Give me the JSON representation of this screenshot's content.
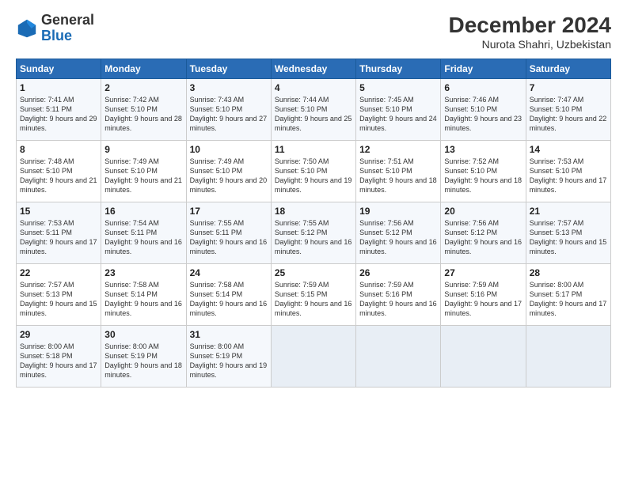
{
  "logo": {
    "name1": "General",
    "name2": "Blue"
  },
  "header": {
    "title": "December 2024",
    "subtitle": "Nurota Shahri, Uzbekistan"
  },
  "weekdays": [
    "Sunday",
    "Monday",
    "Tuesday",
    "Wednesday",
    "Thursday",
    "Friday",
    "Saturday"
  ],
  "weeks": [
    [
      {
        "day": "1",
        "sunrise": "Sunrise: 7:41 AM",
        "sunset": "Sunset: 5:11 PM",
        "daylight": "Daylight: 9 hours and 29 minutes."
      },
      {
        "day": "2",
        "sunrise": "Sunrise: 7:42 AM",
        "sunset": "Sunset: 5:10 PM",
        "daylight": "Daylight: 9 hours and 28 minutes."
      },
      {
        "day": "3",
        "sunrise": "Sunrise: 7:43 AM",
        "sunset": "Sunset: 5:10 PM",
        "daylight": "Daylight: 9 hours and 27 minutes."
      },
      {
        "day": "4",
        "sunrise": "Sunrise: 7:44 AM",
        "sunset": "Sunset: 5:10 PM",
        "daylight": "Daylight: 9 hours and 25 minutes."
      },
      {
        "day": "5",
        "sunrise": "Sunrise: 7:45 AM",
        "sunset": "Sunset: 5:10 PM",
        "daylight": "Daylight: 9 hours and 24 minutes."
      },
      {
        "day": "6",
        "sunrise": "Sunrise: 7:46 AM",
        "sunset": "Sunset: 5:10 PM",
        "daylight": "Daylight: 9 hours and 23 minutes."
      },
      {
        "day": "7",
        "sunrise": "Sunrise: 7:47 AM",
        "sunset": "Sunset: 5:10 PM",
        "daylight": "Daylight: 9 hours and 22 minutes."
      }
    ],
    [
      {
        "day": "8",
        "sunrise": "Sunrise: 7:48 AM",
        "sunset": "Sunset: 5:10 PM",
        "daylight": "Daylight: 9 hours and 21 minutes."
      },
      {
        "day": "9",
        "sunrise": "Sunrise: 7:49 AM",
        "sunset": "Sunset: 5:10 PM",
        "daylight": "Daylight: 9 hours and 21 minutes."
      },
      {
        "day": "10",
        "sunrise": "Sunrise: 7:49 AM",
        "sunset": "Sunset: 5:10 PM",
        "daylight": "Daylight: 9 hours and 20 minutes."
      },
      {
        "day": "11",
        "sunrise": "Sunrise: 7:50 AM",
        "sunset": "Sunset: 5:10 PM",
        "daylight": "Daylight: 9 hours and 19 minutes."
      },
      {
        "day": "12",
        "sunrise": "Sunrise: 7:51 AM",
        "sunset": "Sunset: 5:10 PM",
        "daylight": "Daylight: 9 hours and 18 minutes."
      },
      {
        "day": "13",
        "sunrise": "Sunrise: 7:52 AM",
        "sunset": "Sunset: 5:10 PM",
        "daylight": "Daylight: 9 hours and 18 minutes."
      },
      {
        "day": "14",
        "sunrise": "Sunrise: 7:53 AM",
        "sunset": "Sunset: 5:10 PM",
        "daylight": "Daylight: 9 hours and 17 minutes."
      }
    ],
    [
      {
        "day": "15",
        "sunrise": "Sunrise: 7:53 AM",
        "sunset": "Sunset: 5:11 PM",
        "daylight": "Daylight: 9 hours and 17 minutes."
      },
      {
        "day": "16",
        "sunrise": "Sunrise: 7:54 AM",
        "sunset": "Sunset: 5:11 PM",
        "daylight": "Daylight: 9 hours and 16 minutes."
      },
      {
        "day": "17",
        "sunrise": "Sunrise: 7:55 AM",
        "sunset": "Sunset: 5:11 PM",
        "daylight": "Daylight: 9 hours and 16 minutes."
      },
      {
        "day": "18",
        "sunrise": "Sunrise: 7:55 AM",
        "sunset": "Sunset: 5:12 PM",
        "daylight": "Daylight: 9 hours and 16 minutes."
      },
      {
        "day": "19",
        "sunrise": "Sunrise: 7:56 AM",
        "sunset": "Sunset: 5:12 PM",
        "daylight": "Daylight: 9 hours and 16 minutes."
      },
      {
        "day": "20",
        "sunrise": "Sunrise: 7:56 AM",
        "sunset": "Sunset: 5:12 PM",
        "daylight": "Daylight: 9 hours and 16 minutes."
      },
      {
        "day": "21",
        "sunrise": "Sunrise: 7:57 AM",
        "sunset": "Sunset: 5:13 PM",
        "daylight": "Daylight: 9 hours and 15 minutes."
      }
    ],
    [
      {
        "day": "22",
        "sunrise": "Sunrise: 7:57 AM",
        "sunset": "Sunset: 5:13 PM",
        "daylight": "Daylight: 9 hours and 15 minutes."
      },
      {
        "day": "23",
        "sunrise": "Sunrise: 7:58 AM",
        "sunset": "Sunset: 5:14 PM",
        "daylight": "Daylight: 9 hours and 16 minutes."
      },
      {
        "day": "24",
        "sunrise": "Sunrise: 7:58 AM",
        "sunset": "Sunset: 5:14 PM",
        "daylight": "Daylight: 9 hours and 16 minutes."
      },
      {
        "day": "25",
        "sunrise": "Sunrise: 7:59 AM",
        "sunset": "Sunset: 5:15 PM",
        "daylight": "Daylight: 9 hours and 16 minutes."
      },
      {
        "day": "26",
        "sunrise": "Sunrise: 7:59 AM",
        "sunset": "Sunset: 5:16 PM",
        "daylight": "Daylight: 9 hours and 16 minutes."
      },
      {
        "day": "27",
        "sunrise": "Sunrise: 7:59 AM",
        "sunset": "Sunset: 5:16 PM",
        "daylight": "Daylight: 9 hours and 17 minutes."
      },
      {
        "day": "28",
        "sunrise": "Sunrise: 8:00 AM",
        "sunset": "Sunset: 5:17 PM",
        "daylight": "Daylight: 9 hours and 17 minutes."
      }
    ],
    [
      {
        "day": "29",
        "sunrise": "Sunrise: 8:00 AM",
        "sunset": "Sunset: 5:18 PM",
        "daylight": "Daylight: 9 hours and 17 minutes."
      },
      {
        "day": "30",
        "sunrise": "Sunrise: 8:00 AM",
        "sunset": "Sunset: 5:19 PM",
        "daylight": "Daylight: 9 hours and 18 minutes."
      },
      {
        "day": "31",
        "sunrise": "Sunrise: 8:00 AM",
        "sunset": "Sunset: 5:19 PM",
        "daylight": "Daylight: 9 hours and 19 minutes."
      },
      null,
      null,
      null,
      null
    ]
  ]
}
